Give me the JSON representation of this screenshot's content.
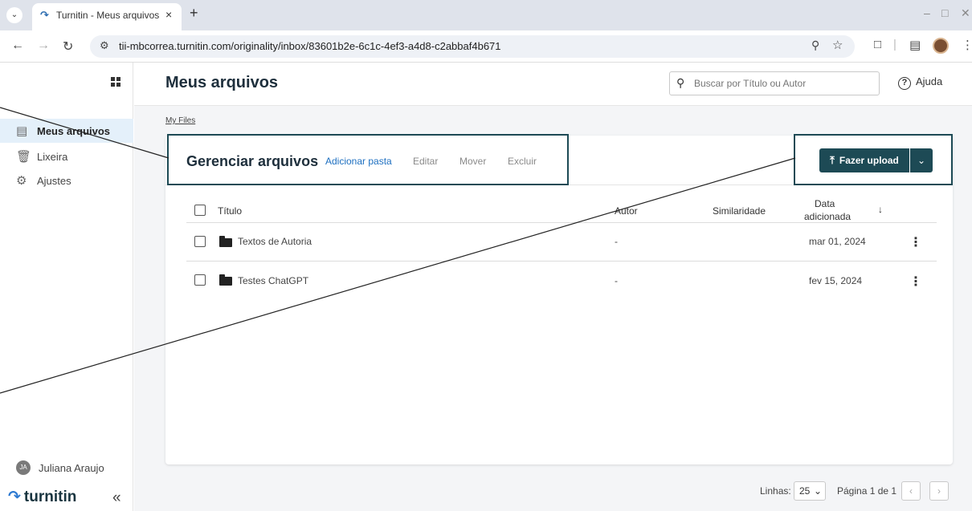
{
  "browser": {
    "tab_title": "Turnitin - Meus arquivos",
    "tab_close": "×",
    "new_tab": "+",
    "url": "tii-mbcorrea.turnitin.com/originality/inbox/83601b2e-6c1c-4ef3-a4d8-c2abbaf4b671"
  },
  "sidebar": {
    "items": [
      {
        "label": "Meus arquivos",
        "icon": "files-icon",
        "active": true
      },
      {
        "label": "Lixeira",
        "icon": "trash-icon",
        "active": false
      },
      {
        "label": "Ajustes",
        "icon": "gear-icon",
        "active": false
      }
    ],
    "user": {
      "initials": "JA",
      "name": "Juliana Araujo"
    },
    "logo": "turnitin",
    "collapse": "«"
  },
  "header": {
    "title": "Meus arquivos",
    "search_placeholder": "Buscar por Título ou Autor",
    "help": "Ajuda"
  },
  "breadcrumb": "My Files",
  "manage": {
    "title": "Gerenciar arquivos",
    "actions": [
      "Adicionar pasta",
      "Editar",
      "Mover",
      "Excluir"
    ],
    "upload": "Fazer upload"
  },
  "table": {
    "columns": {
      "title": "Título",
      "author": "Autor",
      "similarity": "Similaridade",
      "date_line1": "Data",
      "date_line2": "adicionada"
    },
    "rows": [
      {
        "title": "Textos de Autoria",
        "author": "-",
        "similarity": "",
        "date": "mar 01, 2024"
      },
      {
        "title": "Testes ChatGPT",
        "author": "-",
        "similarity": "",
        "date": "fev 15, 2024"
      }
    ]
  },
  "pagination": {
    "rows_label": "Linhas:",
    "rows_value": "25",
    "page_text": "Página 1 de 1"
  }
}
